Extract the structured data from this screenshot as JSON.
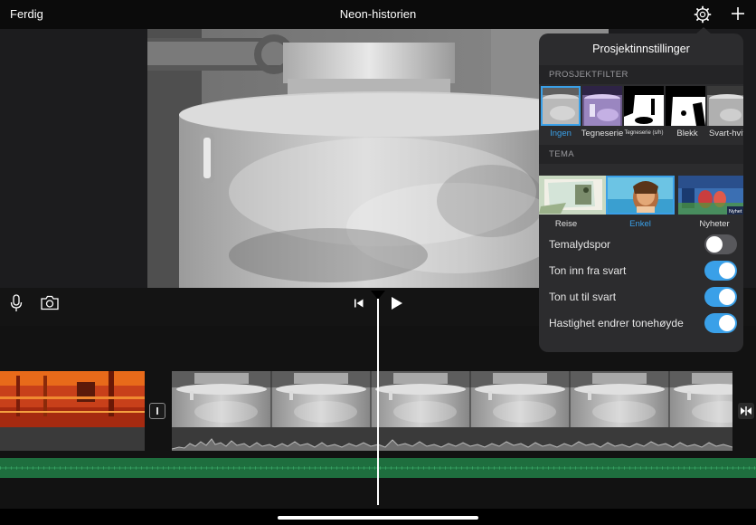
{
  "header": {
    "done_label": "Ferdig",
    "title": "Neon-historien"
  },
  "settings": {
    "title": "Prosjektinnstillinger",
    "filter_section": "PROSJEKTFILTER",
    "filters": [
      {
        "label": "Ingen",
        "selected": true
      },
      {
        "label": "Tegneserie",
        "selected": false
      },
      {
        "label": "Tegneserie (s/h)",
        "selected": false
      },
      {
        "label": "Blekk",
        "selected": false
      },
      {
        "label": "Svart-hvit",
        "selected": false
      }
    ],
    "theme_section": "TEMA",
    "themes": [
      {
        "label": "Reise",
        "selected": false
      },
      {
        "label": "Enkel",
        "selected": true
      },
      {
        "label": "Nyheter",
        "selected": false,
        "badge": "Nyhet"
      }
    ],
    "options": [
      {
        "label": "Temalydspor",
        "on": false
      },
      {
        "label": "Ton inn fra svart",
        "on": true
      },
      {
        "label": "Ton ut til svart",
        "on": true
      },
      {
        "label": "Hastighet endrer tonehøyde",
        "on": true
      }
    ]
  },
  "icons": {
    "settings": "gear-icon",
    "add": "plus-icon",
    "voiceover": "microphone-icon",
    "camera": "camera-icon",
    "skip_start": "skip-back-icon",
    "play": "play-icon"
  },
  "colors": {
    "accent": "#3aa0e8",
    "audio_track": "#1e6e3e",
    "popover_bg": "#2c2c2e"
  }
}
